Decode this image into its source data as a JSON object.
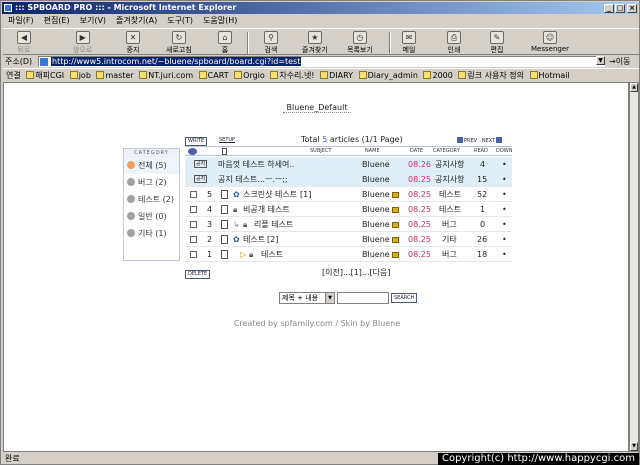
{
  "window": {
    "title": "::: SPBOARD PRO ::: - Microsoft Internet Explorer"
  },
  "menu": [
    "파일(F)",
    "편집(E)",
    "보기(V)",
    "즐겨찾기(A)",
    "도구(T)",
    "도움말(H)"
  ],
  "toolbar": {
    "back": "뒤로",
    "forward": "앞으로",
    "stop": "중지",
    "refresh": "새로고침",
    "home": "홈",
    "search": "검색",
    "favorites": "즐겨찾기",
    "history": "목록보기",
    "mail": "메일",
    "print": "인쇄",
    "edit": "편집",
    "messenger": "Messenger"
  },
  "address": {
    "label": "주소(D)",
    "url": "http://www5.introcom.net/~bluene/spboard/board.cgi?id=test",
    "go": "이동"
  },
  "links": {
    "label": "연결",
    "items": [
      "해피CGI",
      "job",
      "master",
      "NT.juri.com",
      "CART",
      "Orgio",
      "차수리.넷!",
      "DIARY",
      "Diary_admin",
      "2000",
      "링크 사용자 정의",
      "Hotmail"
    ]
  },
  "board": {
    "name": "Bluene_Default",
    "write": "WRITE",
    "setup": "SETUP",
    "total_prefix": "Total",
    "total_count": "5",
    "total_suffix": "articles (1/1 Page)",
    "prev": "PREV",
    "next": "NEXT",
    "headers": {
      "subject": "SUBJECT",
      "name": "NAME",
      "date": "DATE",
      "category": "CATEGORY",
      "read": "READ",
      "down": "DOWN"
    },
    "category_header": "CATEGORY",
    "categories": [
      {
        "label": "전체",
        "count": "(5)"
      },
      {
        "label": "버그",
        "count": "(2)"
      },
      {
        "label": "테스트",
        "count": "(2)"
      },
      {
        "label": "일반",
        "count": "(0)"
      },
      {
        "label": "기타",
        "count": "(1)"
      }
    ],
    "notice_tag": "공지",
    "rows": [
      {
        "num": "",
        "subject": "마음껏 테스트 하세여..",
        "name": "Bluene",
        "date": "08.26",
        "category": "공지사항",
        "read": "4",
        "down": "•"
      },
      {
        "num": "",
        "subject": "공지 테스트...ㅡ.ㅡ;;",
        "name": "Bluene",
        "date": "08.25",
        "category": "공지사항",
        "read": "15",
        "down": "•"
      },
      {
        "num": "5",
        "subject": "스크린샷 테스트",
        "comments": "[1]",
        "name": "Bluene",
        "date": "08.25",
        "category": "테스트",
        "read": "52",
        "down": "•"
      },
      {
        "num": "4",
        "subject": "비공개 테스트",
        "comments": "",
        "name": "Bluene",
        "date": "08.25",
        "category": "테스트",
        "read": "1",
        "down": "•"
      },
      {
        "num": "3",
        "subject": "리플 테스트",
        "comments": "",
        "name": "Bluene",
        "date": "08.25",
        "category": "버그",
        "read": "0",
        "down": "•"
      },
      {
        "num": "2",
        "subject": "테스트",
        "comments": "[2]",
        "name": "Bluene",
        "date": "08.25",
        "category": "기타",
        "read": "26",
        "down": "•"
      },
      {
        "num": "1",
        "subject": "테스트",
        "comments": "",
        "name": "Bluene",
        "date": "08.25",
        "category": "버그",
        "read": "18",
        "down": "•"
      }
    ],
    "delete": "DELETE",
    "pager": "[이전]...[1]...[다음]",
    "search_select": "제목 + 내용",
    "search_button": "SEARCH",
    "credit": "Created by spfamily.com / Skin by Bluene"
  },
  "status": {
    "text": "완료",
    "copyright": "Copyright(c) http://www.happycgi.com"
  }
}
